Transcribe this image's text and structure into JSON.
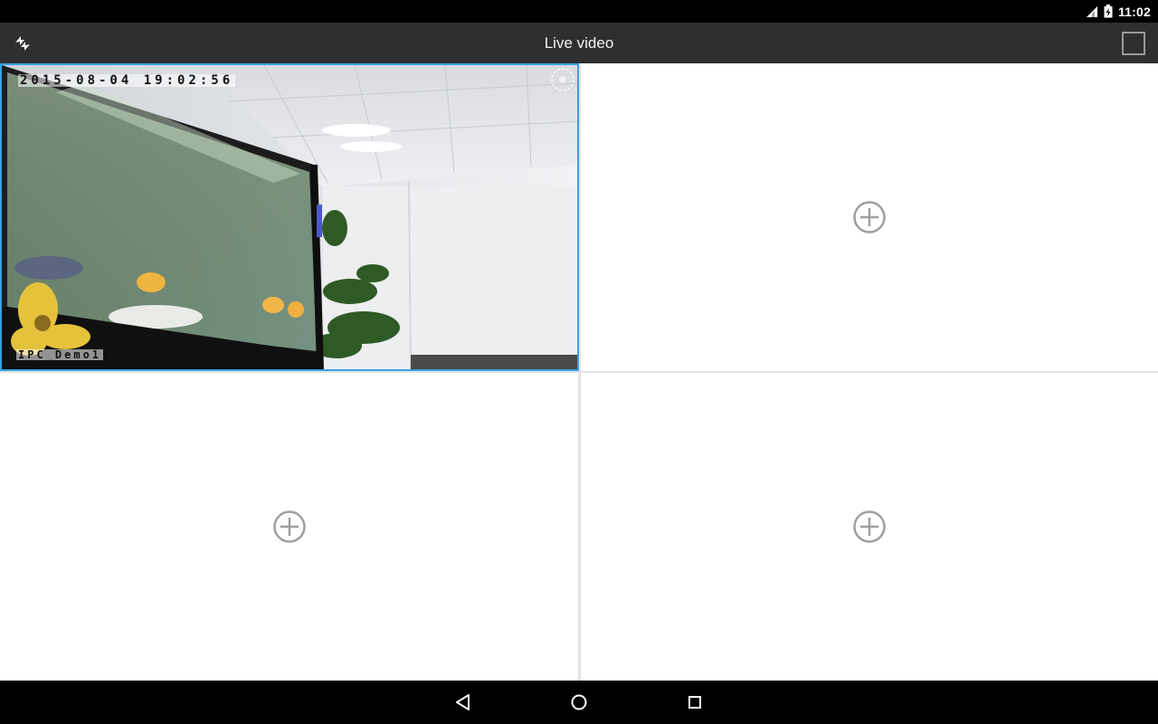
{
  "status_bar": {
    "time": "11:02",
    "icons": [
      "signal-icon",
      "battery-charging-icon"
    ]
  },
  "action_bar": {
    "title": "Live video",
    "left_icon": "switch-stream-icon",
    "right_icon": "layout-square-icon"
  },
  "grid": {
    "selected_cell": 1,
    "cells": [
      {
        "index": 1,
        "state": "live",
        "osd_timestamp": "2015-08-04 19:02:56",
        "osd_channel_name": "IPC_Demo1",
        "badge_icon": "recording-badge-icon"
      },
      {
        "index": 2,
        "state": "empty",
        "icon": "add-channel-icon"
      },
      {
        "index": 3,
        "state": "empty",
        "icon": "add-channel-icon"
      },
      {
        "index": 4,
        "state": "empty",
        "icon": "add-channel-icon"
      }
    ]
  },
  "nav_bar": {
    "icons": [
      "back-icon",
      "home-icon",
      "recent-apps-icon"
    ]
  },
  "colors": {
    "status_bar": "#000000",
    "action_bar": "#2f2f2f",
    "selected_border": "#35a2e3",
    "empty_cell": "#ffffff",
    "grid_gap": "#e3e3e3",
    "add_icon": "#9e9e9e"
  }
}
